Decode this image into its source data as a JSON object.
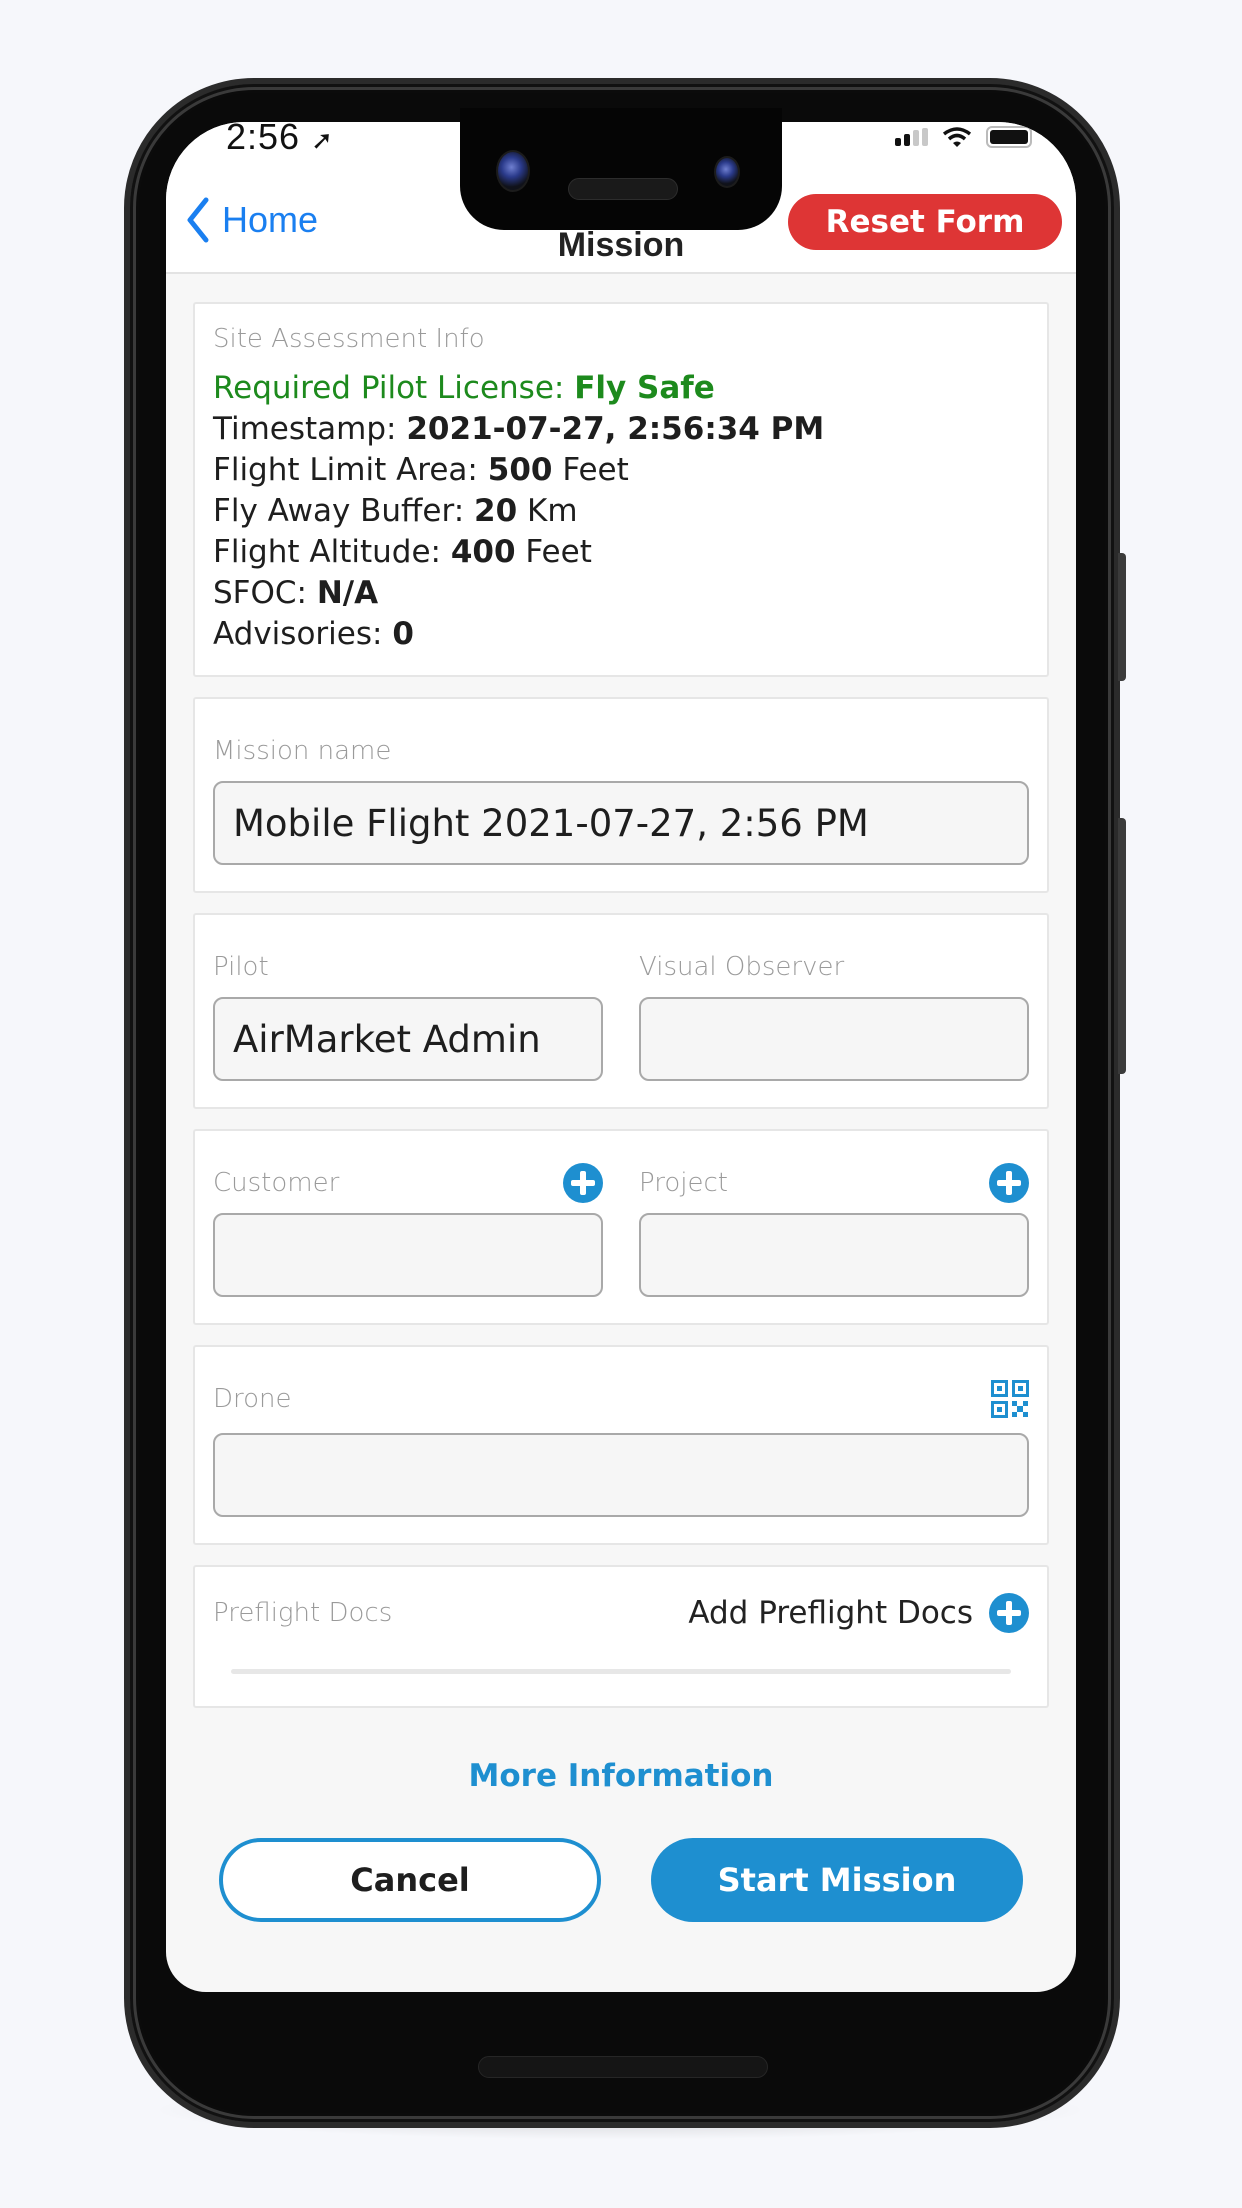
{
  "status_bar": {
    "time": "2:56",
    "location_icon": "location-arrow-icon",
    "signal_icon": "cellular-signal-icon",
    "wifi_icon": "wifi-icon",
    "battery_icon": "battery-icon"
  },
  "nav": {
    "back_label": "Home",
    "back_icon": "chevron-left-icon",
    "title": "Mission",
    "reset_label": "Reset Form"
  },
  "site_assessment": {
    "label": "Site Assessment Info",
    "lines": [
      {
        "key": "Required Pilot License:",
        "value": "Fly Safe",
        "suffix": ""
      },
      {
        "key": "Timestamp:",
        "value": "2021-07-27, 2:56:34 PM",
        "suffix": ""
      },
      {
        "key": "Flight Limit Area:",
        "value": "500",
        "suffix": "Feet"
      },
      {
        "key": "Fly Away Buffer:",
        "value": "20",
        "suffix": "Km"
      },
      {
        "key": "Flight Altitude:",
        "value": "400",
        "suffix": "Feet"
      },
      {
        "key": "SFOC:",
        "value": "N/A",
        "suffix": ""
      },
      {
        "key": "Advisories:",
        "value": "0",
        "suffix": ""
      }
    ]
  },
  "mission_name": {
    "label": "Mission name",
    "value": "Mobile Flight 2021-07-27, 2:56 PM"
  },
  "pilot": {
    "label": "Pilot",
    "value": "AirMarket Admin"
  },
  "visual_observer": {
    "label": "Visual Observer",
    "value": ""
  },
  "customer": {
    "label": "Customer",
    "value": "",
    "add_icon": "plus-circle-icon"
  },
  "project": {
    "label": "Project",
    "value": "",
    "add_icon": "plus-circle-icon"
  },
  "drone": {
    "label": "Drone",
    "value": "",
    "scan_icon": "qr-code-icon"
  },
  "preflight_docs": {
    "label": "Preflight Docs",
    "add_label": "Add Preflight Docs",
    "add_icon": "plus-circle-icon"
  },
  "more_info_label": "More Information",
  "actions": {
    "cancel_label": "Cancel",
    "start_label": "Start Mission"
  },
  "colors": {
    "accent_blue": "#1e8fd0",
    "ios_blue": "#1a7ff0",
    "reset_red": "#de3535",
    "license_green": "#1d8a1d"
  }
}
